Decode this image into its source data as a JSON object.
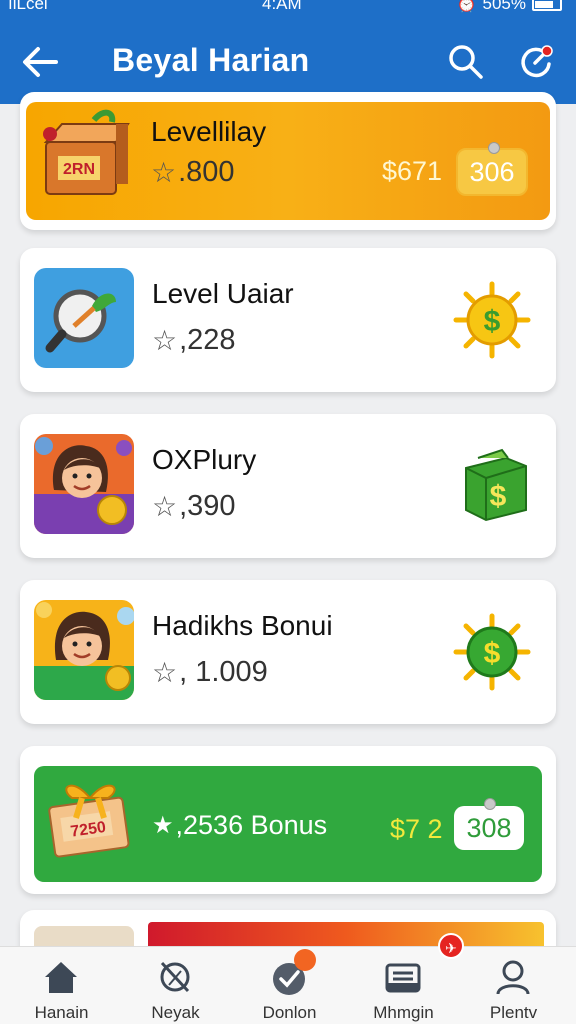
{
  "status_bar": {
    "carrier": "ılLcel",
    "time": "4:AM",
    "battery": "505%"
  },
  "app_bar": {
    "title": "Beyal Harian"
  },
  "tasks": [
    {
      "name": "Levellilay",
      "rating": ".800",
      "price": "$671",
      "reward": "306"
    },
    {
      "name": "Level Uaiar",
      "rating": ",228"
    },
    {
      "name": "OXPlury",
      "rating": ",390"
    },
    {
      "name": "Hadikhs Bonui",
      "rating": ", 1.009"
    },
    {
      "rating_text": ",2536 Bonus",
      "price": "$7 2",
      "reward": "308"
    }
  ],
  "bottom_nav": [
    {
      "label": "Hanain",
      "icon": "home-icon"
    },
    {
      "label": "Neyak",
      "icon": "whisk-icon"
    },
    {
      "label": "Donlon",
      "icon": "check-circle-icon"
    },
    {
      "label": "Mhmgin",
      "icon": "inbox-icon"
    },
    {
      "label": "Plentv",
      "icon": "user-icon"
    }
  ],
  "colors": {
    "app_bar": "#1e6fc8",
    "featured_orange": "#f7a600",
    "bonus_green": "#30a93f",
    "badge_orange": "#f26522",
    "badge_red": "#e52421"
  }
}
